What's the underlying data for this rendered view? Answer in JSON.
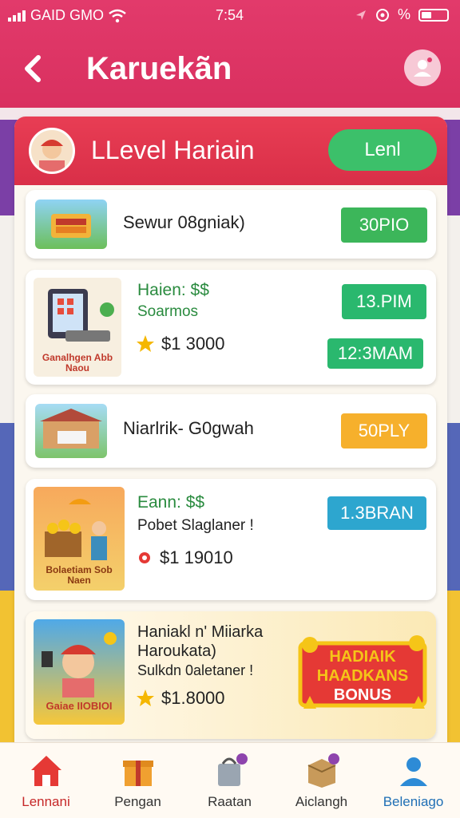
{
  "status_bar": {
    "carrier": "GAID GMO",
    "time": "7:54",
    "battery_text": "%"
  },
  "header": {
    "title": "Karuekãn"
  },
  "panel": {
    "title": "LLevel Hariain",
    "level_button": "Lenl"
  },
  "cards": [
    {
      "title": "Sewur 08gniak)",
      "button": "30PIO"
    },
    {
      "green_text": "Haien: $$",
      "subtitle": "Soarmos",
      "price": "$1 3000",
      "button1": "13.PIM",
      "button2": "12:3MAM",
      "thumb_text": "Ganalhgen Abb Naou"
    },
    {
      "title": "Niarlrik- G0gwah",
      "button": "50PLY"
    },
    {
      "green_text": "Eann: $$",
      "subtitle": "Pobet Slaglaner !",
      "price": "$1 19010",
      "button": "1.3BRAN",
      "thumb_text": "Bolaetiam Sob Naen"
    },
    {
      "title": "Haniakl n' Miiarka Haroukata)",
      "subtitle": "Sulkdn 0aletaner !",
      "price": "$1.8000",
      "thumb_text": "Gaiae IIOBIOI",
      "badge_line1": "HADIAIK",
      "badge_line2": "HAADKANS",
      "badge_line3": "BONUS"
    }
  ],
  "bottom_nav": [
    {
      "label": "Lennani",
      "icon": "home-icon",
      "color": "#c62828"
    },
    {
      "label": "Pengan",
      "icon": "gift-icon",
      "color": "#333333"
    },
    {
      "label": "Raatan",
      "icon": "shopping-bag-icon",
      "color": "#333333"
    },
    {
      "label": "Aiclangh",
      "icon": "box-icon",
      "color": "#333333"
    },
    {
      "label": "Beleniago",
      "icon": "profile-icon",
      "color": "#1f6fb5"
    }
  ],
  "colors": {
    "header": "#e23a6b",
    "panel_header": "#e83d54",
    "green": "#3cb65a",
    "orange": "#f6b02c",
    "blue": "#2da6cf"
  }
}
